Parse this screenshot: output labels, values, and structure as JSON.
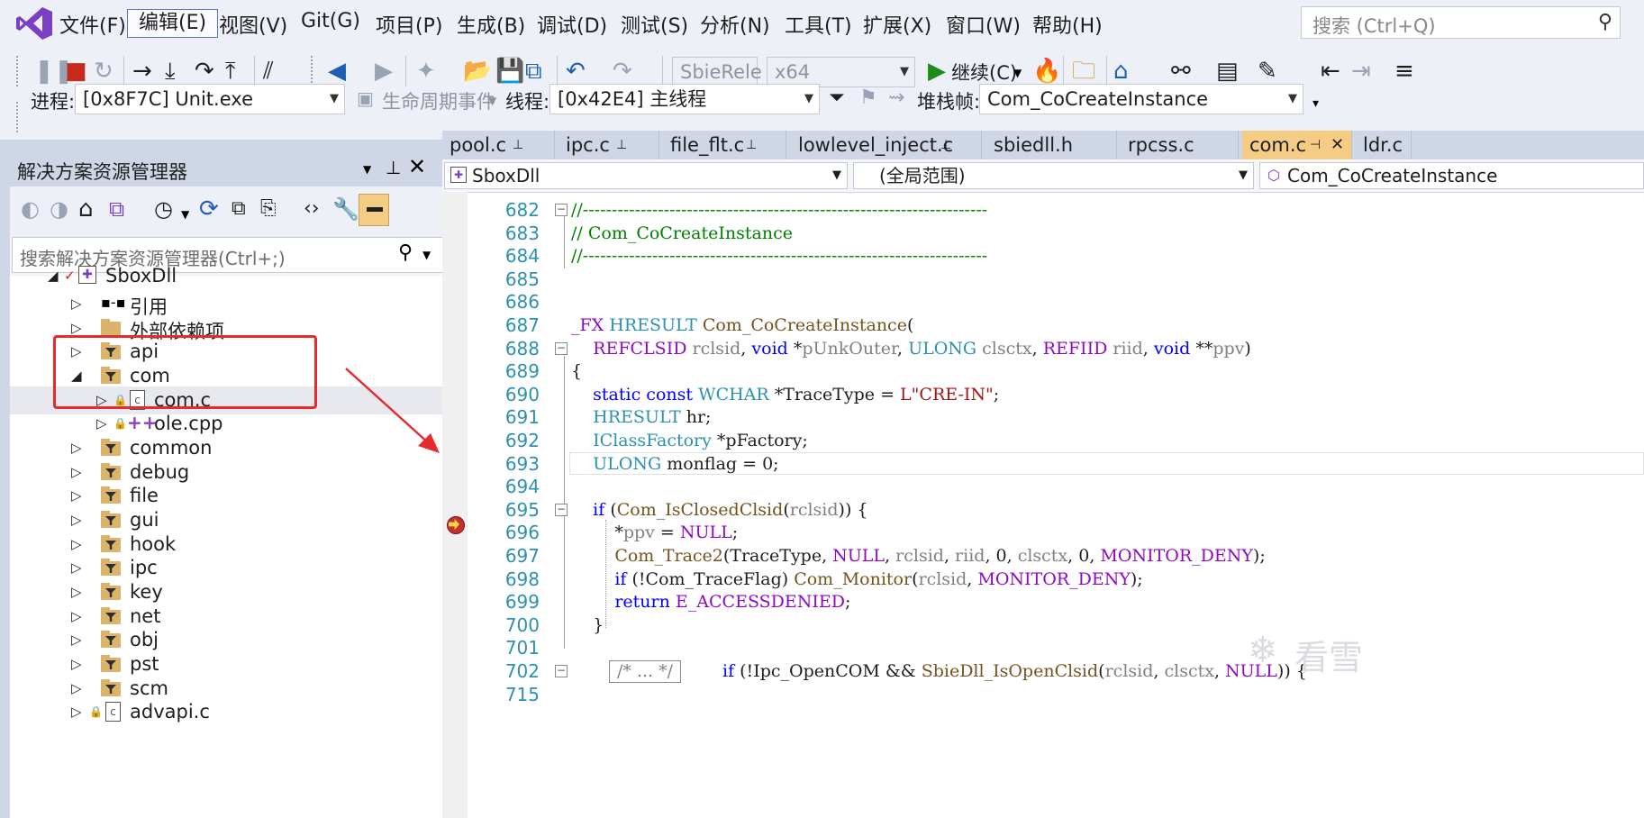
{
  "menu": {
    "items": [
      "文件(F)",
      "编辑(E)",
      "视图(V)",
      "Git(G)",
      "项目(P)",
      "生成(B)",
      "调试(D)",
      "测试(S)",
      "分析(N)",
      "工具(T)",
      "扩展(X)",
      "窗口(W)",
      "帮助(H)"
    ],
    "active_index": 1,
    "search_placeholder": "搜索 (Ctrl+Q)"
  },
  "toolbar": {
    "config": "SbieRele",
    "platform": "x64",
    "continue_label": "继续(C)",
    "process_label": "进程:",
    "process_value": "[0x8F7C] Unit.exe",
    "lifecycle_label": "生命周期事件",
    "thread_label": "线程:",
    "thread_value": "[0x42E4] 主线程",
    "stackframe_label": "堆栈帧:",
    "stackframe_value": "Com_CoCreateInstance"
  },
  "solution_explorer": {
    "title": "解决方案资源管理器",
    "search_placeholder": "搜索解决方案资源管理器(Ctrl+;)",
    "project": "SboxDll",
    "nodes": [
      "引用",
      "外部依赖项",
      "api",
      "com",
      "com.c",
      "ole.cpp",
      "common",
      "debug",
      "file",
      "gui",
      "hook",
      "ipc",
      "key",
      "net",
      "obj",
      "pst",
      "scm",
      "advapi.c"
    ]
  },
  "editor": {
    "tabs": [
      "pool.c",
      "ipc.c",
      "file_flt.c",
      "lowlevel_inject.c",
      "sbiedll.h",
      "rpcss.c",
      "com.c",
      "ldr.c"
    ],
    "active_tab": "com.c",
    "nav_project": "SboxDll",
    "nav_scope": "(全局范围)",
    "nav_member": "Com_CoCreateInstance",
    "line_numbers": [
      "682",
      "683",
      "684",
      "685",
      "686",
      "687",
      "688",
      "689",
      "690",
      "691",
      "692",
      "693",
      "694",
      "695",
      "696",
      "697",
      "698",
      "699",
      "700",
      "701",
      "702",
      "715"
    ],
    "collapsed_block": "/* ... */"
  },
  "watermark": "看雪"
}
